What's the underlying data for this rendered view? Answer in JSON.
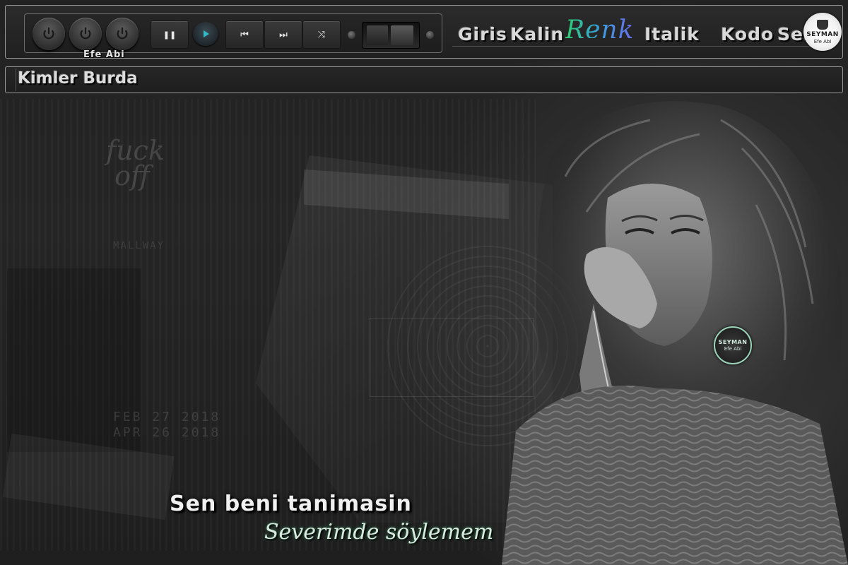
{
  "player": {
    "label": "Efe Abi",
    "buttons": [
      "power-1",
      "power-2",
      "power-3",
      "pause",
      "play",
      "previous",
      "next",
      "shuffle"
    ],
    "icons": {
      "pause": "❚❚",
      "previous": "⏮",
      "next": "⏭",
      "shuffle": "⤨"
    }
  },
  "nav": {
    "items": [
      {
        "label": "Giris"
      },
      {
        "label": "Kalin"
      },
      {
        "label": "Renk"
      },
      {
        "label": "Italik"
      },
      {
        "label": "Kodo"
      },
      {
        "label": "Ses"
      }
    ]
  },
  "badge": {
    "title": "SEYMAN",
    "subtitle": "Efe Abi"
  },
  "who": {
    "title": "Kimler Burda"
  },
  "background": {
    "ghost_text_1": "fuck\n off",
    "ghost_text_2": "FEB 27 2018",
    "ghost_text_3": "APR 26 2018",
    "ghost_text_4": "MALLWAY"
  },
  "lyrics": {
    "line1": "Sen beni tanimasin",
    "line2": "Severimde söylemem"
  },
  "colors": {
    "renk_gradient": [
      "#2ecc71",
      "#3aa0e0",
      "#6a6ae8"
    ],
    "accent_play": "#2fb9c9",
    "badge_ring": "#9ad3b8"
  }
}
